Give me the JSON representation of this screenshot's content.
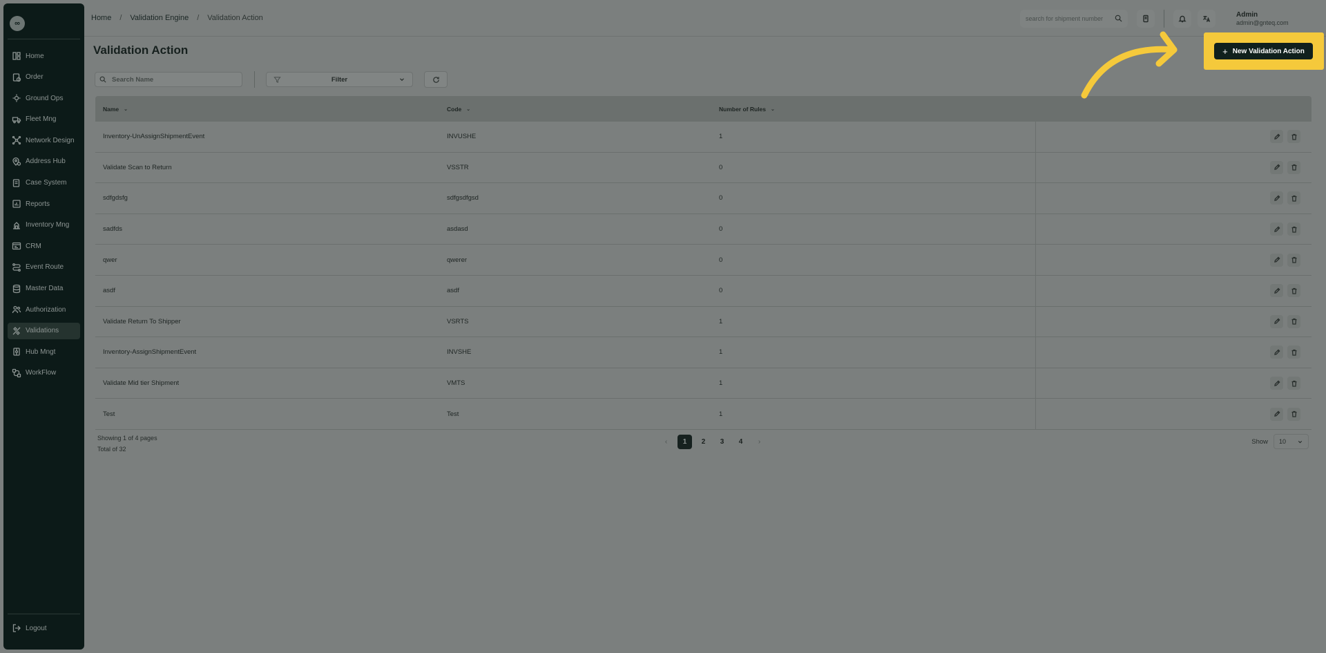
{
  "sidebar": {
    "logo_text": "∞",
    "items": [
      {
        "label": "Home",
        "icon": "dashboard-icon",
        "active": false
      },
      {
        "label": "Order",
        "icon": "order-icon",
        "active": false
      },
      {
        "label": "Ground Ops",
        "icon": "ground-ops-icon",
        "active": false
      },
      {
        "label": "Fleet Mng",
        "icon": "truck-icon",
        "active": false
      },
      {
        "label": "Network Design",
        "icon": "network-icon",
        "active": false
      },
      {
        "label": "Address Hub",
        "icon": "map-pin-icon",
        "active": false
      },
      {
        "label": "Case System",
        "icon": "case-icon",
        "active": false
      },
      {
        "label": "Reports",
        "icon": "report-icon",
        "active": false
      },
      {
        "label": "Inventory Mng",
        "icon": "inventory-icon",
        "active": false
      },
      {
        "label": "CRM",
        "icon": "crm-icon",
        "active": false
      },
      {
        "label": "Event Route",
        "icon": "route-icon",
        "active": false
      },
      {
        "label": "Master Data",
        "icon": "database-icon",
        "active": false
      },
      {
        "label": "Authorization",
        "icon": "users-icon",
        "active": false
      },
      {
        "label": "Validations",
        "icon": "validation-icon",
        "active": true
      },
      {
        "label": "Hub Mngt",
        "icon": "hub-icon",
        "active": false
      },
      {
        "label": "WorkFlow",
        "icon": "workflow-icon",
        "active": false
      }
    ],
    "logout_label": "Logout"
  },
  "header": {
    "breadcrumb": [
      "Home",
      "Validation Engine",
      "Validation Action"
    ],
    "search_placeholder": "search for shipment number",
    "user_name": "Admin",
    "user_email": "admin@gnteq.com"
  },
  "page": {
    "title": "Validation Action",
    "search_placeholder": "Search Name",
    "filter_label": "Filter",
    "new_button_label": "New Validation Action"
  },
  "table": {
    "columns": [
      "Name",
      "Code",
      "Number of Rules"
    ],
    "rows": [
      {
        "name": "Inventory-UnAssignShipmentEvent",
        "code": "INVUSHE",
        "rules": "1"
      },
      {
        "name": "Validate Scan to Return",
        "code": "VSSTR",
        "rules": "0"
      },
      {
        "name": "sdfgdsfg",
        "code": "sdfgsdfgsd",
        "rules": "0"
      },
      {
        "name": "sadfds",
        "code": "asdasd",
        "rules": "0"
      },
      {
        "name": "qwer",
        "code": "qwerer",
        "rules": "0"
      },
      {
        "name": "asdf",
        "code": "asdf",
        "rules": "0"
      },
      {
        "name": "Validate Return To Shipper",
        "code": "VSRTS",
        "rules": "1"
      },
      {
        "name": "Inventory-AssignShipmentEvent",
        "code": "INVSHE",
        "rules": "1"
      },
      {
        "name": "Validate Mid tier Shipment",
        "code": "VMTS",
        "rules": "1"
      },
      {
        "name": "Test",
        "code": "Test",
        "rules": "1"
      }
    ]
  },
  "footer": {
    "showing": "Showing 1 of 4 pages",
    "total": "Total of 32",
    "pages": [
      "1",
      "2",
      "3",
      "4"
    ],
    "current_page": "1",
    "show_label": "Show",
    "page_size": "10"
  },
  "colors": {
    "highlight": "#f5c93b",
    "sidebar_bg": "#0c1a18",
    "primary_button": "#10201d"
  }
}
